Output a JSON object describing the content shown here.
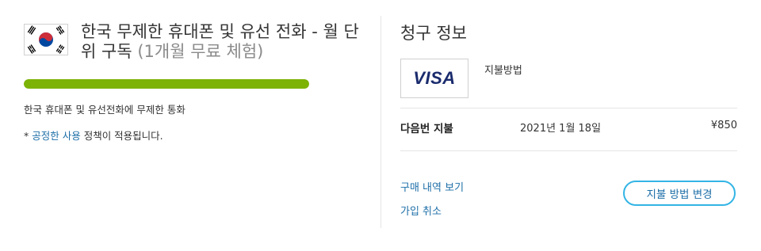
{
  "plan": {
    "flag_icon": "south-korea-flag-icon",
    "title_main": "한국 무제한 휴대폰 및 유선 전화 - 월 단위 구독",
    "title_trial": "(1개월 무료 체험)",
    "progress_percent": 100,
    "progress_color": "#7cb305",
    "description": "한국 휴대폰 및 유선전화에 무제한 통화",
    "policy_prefix": "* ",
    "policy_link": "공정한 사용",
    "policy_suffix": " 정책이 적용됩니다."
  },
  "billing": {
    "title": "청구 정보",
    "card_brand": "VISA",
    "payment_method_label": "지불방법",
    "next_payment_label": "다음번 지불",
    "next_payment_date": "2021년 1월 18일",
    "next_payment_amount": "¥850",
    "view_history_link": "구매 내역 보기",
    "cancel_link": "가입 취소",
    "change_payment_button": "지불 방법 변경",
    "accent_color": "#33b5e5",
    "link_color": "#1e6fa8"
  }
}
